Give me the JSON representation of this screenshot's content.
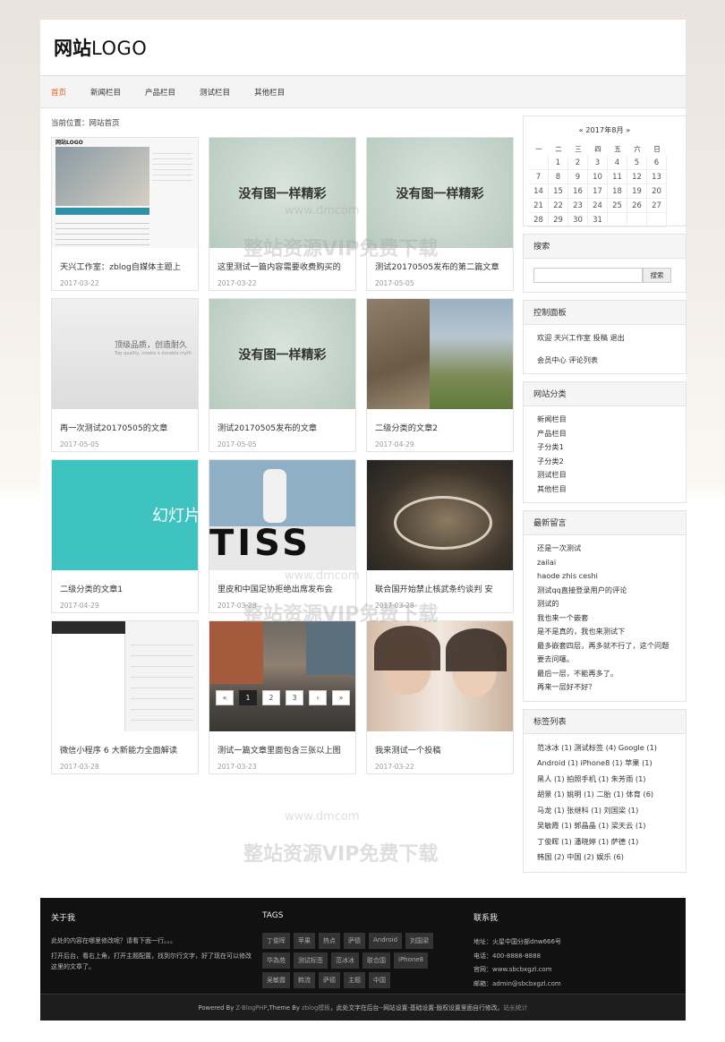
{
  "header": {
    "logo_bold": "网站",
    "logo_text": "LOGO"
  },
  "nav": [
    "首页",
    "新闻栏目",
    "产品栏目",
    "测试栏目",
    "其他栏目"
  ],
  "breadcrumb": "当前位置：网站首页",
  "cards": [
    {
      "title": "天兴工作室：zblog自媒体主题上",
      "date": "2017-03-22",
      "thumb": "screenshot"
    },
    {
      "title": "这里测试一篇内容需要收费购买的",
      "date": "2017-03-22",
      "thumb": "noimg"
    },
    {
      "title": "测试20170505发布的第二篇文章",
      "date": "2017-05-05",
      "thumb": "noimg"
    },
    {
      "title": "再一次测试20170505的文章",
      "date": "2017-05-05",
      "thumb": "banner"
    },
    {
      "title": "测试20170505发布的文章",
      "date": "2017-05-05",
      "thumb": "noimg"
    },
    {
      "title": "二级分类的文章2",
      "date": "2017-04-29",
      "thumb": "rock"
    },
    {
      "title": "二级分类的文章1",
      "date": "2017-04-29",
      "thumb": "slide"
    },
    {
      "title": "里皮和中国足协拒绝出席发布会",
      "date": "2017-03-28",
      "thumb": "soccer"
    },
    {
      "title": "联合国开始禁止核武条约谈判 安",
      "date": "2017-03-28",
      "thumb": "un"
    },
    {
      "title": "微信小程序 6 大新能力全面解读",
      "date": "2017-03-28",
      "thumb": "phone"
    },
    {
      "title": "测试一篇文章里面包含三张以上图",
      "date": "2017-03-23",
      "thumb": "street"
    },
    {
      "title": "我来测试一个投稿",
      "date": "2017-03-22",
      "thumb": "people"
    }
  ],
  "placeholders": {
    "noimg": "没有图一样精彩",
    "slide": "幻灯片",
    "banner_main": "顶级品质，创造耐久",
    "banner_sub": "Top quality, create a durable myth"
  },
  "pager": [
    "«",
    "1",
    "2",
    "3",
    "›",
    "»"
  ],
  "calendar": {
    "title": "«   2017年8月   »",
    "weekdays": [
      "一",
      "二",
      "三",
      "四",
      "五",
      "六",
      "日"
    ],
    "rows": [
      [
        "",
        "1",
        "2",
        "3",
        "4",
        "5",
        "6"
      ],
      [
        "7",
        "8",
        "9",
        "10",
        "11",
        "12",
        "13"
      ],
      [
        "14",
        "15",
        "16",
        "17",
        "18",
        "19",
        "20"
      ],
      [
        "21",
        "22",
        "23",
        "24",
        "25",
        "26",
        "27"
      ],
      [
        "28",
        "29",
        "30",
        "31",
        "",
        "",
        ""
      ]
    ]
  },
  "search": {
    "title": "搜索",
    "button": "搜索"
  },
  "control": {
    "title": "控制面板",
    "line1": "欢迎 天兴工作室 投稿 退出",
    "line2": "会员中心  评论列表"
  },
  "categories": {
    "title": "网站分类",
    "items": [
      "新闻栏目",
      "产品栏目",
      "子分类1",
      "子分类2",
      "测试栏目",
      "其他栏目"
    ]
  },
  "comments": {
    "title": "最新留言",
    "items": [
      "还是一次测试",
      "zailai",
      "haode zhis ceshi",
      "测试qq直接登录用户的评论",
      "测试的",
      "我也来一个嵌套",
      "是不是真的，我也来测试下",
      "最多嵌套四层，再多就不行了，这个问题要去问噻。",
      "最后一层，不能再多了。",
      "再来一层好不好？"
    ]
  },
  "tagsbox": {
    "title": "标签列表",
    "lines": [
      "范冰冰 (1)  测试标签 (4)  Google (1)",
      "Android (1)  iPhone8 (1)  苹果 (1)",
      "黑人 (1)  拍照手机 (1)  朱芳雨 (1)",
      "胡景 (1)  姚明 (1)  二胎 (1)  体育 (6)",
      "马龙 (1)  张继科 (1)  刘国梁 (1)",
      "吴敏霞 (1)  郭晶晶 (1)  梁天云 (1)",
      "丁俊晖 (1)  潘晓婷 (1)  萨德 (1)",
      "韩国 (2)  中国 (2)  娱乐 (6)"
    ]
  },
  "footer": {
    "about_title": "关于我",
    "about_lines": [
      "此处的内容在哪里修改呢？请看下面一行。。。",
      "打开后台，看右上角，打开主题配置，找到尔行文字，好了现在可以修改这里的文章了。"
    ],
    "tags_title": "TAGS",
    "tags": [
      "丁俊晖",
      "苹果",
      "热点",
      "萨德",
      "Android",
      "刘国梁",
      "华為苑",
      "测试标签",
      "范冰冰",
      "联合国",
      "iPhone8",
      "吴敏霞",
      "韩流",
      "萨德",
      "主题",
      "中国"
    ],
    "contact_title": "联系我",
    "contact": [
      "地址：火星中国分部dnw666号",
      "电话：400-8888-8888",
      "官网：www.sbcbxgzl.com",
      "邮箱：admin@sbcbxgzl.com"
    ],
    "copy_a": "Powered By ",
    "copy_b": "Z-BlogPHP",
    "copy_c": ",Theme By ",
    "copy_d": "zblog模板",
    "copy_e": "，此处文字在后台--网站设置-基础设置-版权设置里面自行修改。",
    "copy_f": "站长统计"
  },
  "watermark": {
    "site": "www.dmcom",
    "vip": "整站资源VIP免费下载"
  }
}
